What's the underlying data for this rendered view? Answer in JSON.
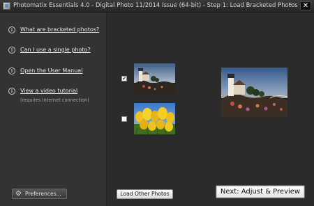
{
  "window": {
    "title": "Photomatix Essentials  4.0 - Digital Photo 11/2014 Issue (64-bit) - Step 1: Load Bracketed Photos",
    "minimize_glyph": "–",
    "close_glyph": "✕"
  },
  "help": {
    "items": [
      {
        "label": "What are bracketed photos?",
        "icon": "info-icon"
      },
      {
        "label": "Can I use a single photo?",
        "icon": "info-icon"
      },
      {
        "label": "Open the User Manual",
        "icon": "info-icon"
      },
      {
        "label": "View a video tutorial",
        "icon": "info-icon",
        "note": "(requires Internet connection)"
      }
    ],
    "icon_glyph": "i"
  },
  "preferences": {
    "label": "Preferences...",
    "icon": "gear-icon",
    "glyph": "⚙"
  },
  "photos": [
    {
      "selected": true,
      "check_glyph": "✔",
      "subject": "lighthouse"
    },
    {
      "selected": false,
      "check_glyph": "",
      "subject": "yellow-tulips"
    }
  ],
  "preview": {
    "subject": "lighthouse"
  },
  "buttons": {
    "load_other": "Load Other Photos",
    "next": "Next: Adjust & Preview"
  },
  "colors": {
    "background": "#2b2b2b",
    "panel": "#333333",
    "text": "#e6e6e6"
  }
}
